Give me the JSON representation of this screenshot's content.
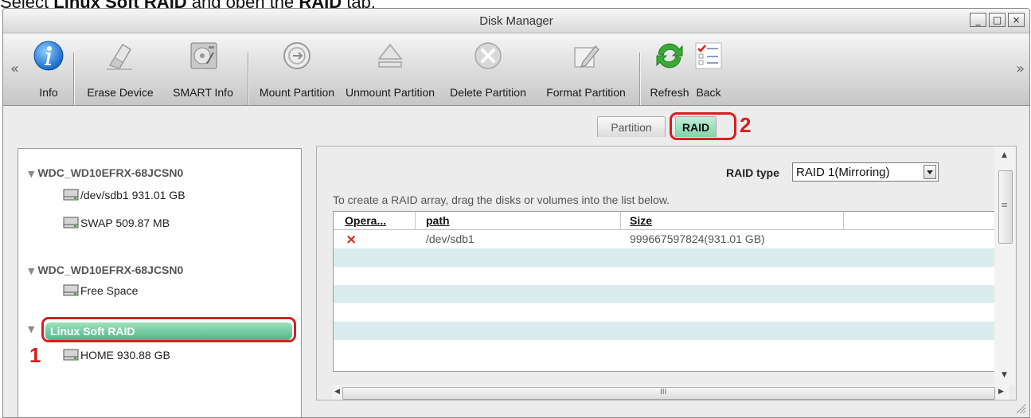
{
  "caption": {
    "verb": "Select ",
    "bold1": "Linux Soft RAID",
    "mid": " and open the ",
    "bold2": "RAID",
    "end": " tab."
  },
  "window": {
    "title": "Disk Manager",
    "controls": {
      "minimize": "_",
      "maximize": "□",
      "close": "×"
    }
  },
  "toolbar": {
    "scroll_left": "«",
    "scroll_right": "»",
    "buttons": [
      {
        "label": "Info",
        "icon": "info-icon"
      },
      {
        "label": "Erase Device",
        "icon": "eraser-icon"
      },
      {
        "label": "SMART Info",
        "icon": "hard-drive-icon"
      },
      {
        "label": "Mount Partition",
        "icon": "mount-icon"
      },
      {
        "label": "Unmount Partition",
        "icon": "eject-icon"
      },
      {
        "label": "Delete Partition",
        "icon": "delete-icon"
      },
      {
        "label": "Format Partition",
        "icon": "format-pencil-icon"
      },
      {
        "label": "Refresh",
        "icon": "refresh-icon"
      },
      {
        "label": "Back",
        "icon": "checklist-icon"
      }
    ]
  },
  "tabs": {
    "partition": "Partition",
    "raid": "RAID",
    "active": "RAID"
  },
  "annotations": {
    "step1": "1",
    "step2": "2",
    "color": "#d81e1e"
  },
  "tree": {
    "disks": [
      {
        "name": "WDC_WD10EFRX-68JCSN0",
        "items": [
          "/dev/sdb1 931.01 GB",
          "SWAP 509.87 MB"
        ]
      },
      {
        "name": "WDC_WD10EFRX-68JCSN0",
        "items": [
          "Free Space"
        ]
      }
    ],
    "raid": {
      "name": "Linux Soft RAID",
      "items": [
        "HOME 930.88 GB"
      ],
      "selected": true
    }
  },
  "raid_panel": {
    "raid_type_label": "RAID type",
    "raid_type_value": "RAID 1(Mirroring)",
    "instructions": "To create a RAID array, drag the disks or volumes into the list below.",
    "columns": [
      "Opera...",
      "path",
      "Size"
    ],
    "rows": [
      {
        "operation": "×",
        "path": "/dev/sdb1",
        "size": "999667597824(931.01 GB)"
      }
    ],
    "scrollbar_mid": "≡",
    "hscroll_mid": "III"
  },
  "colors": {
    "accent_green": "#4fb888",
    "delete_red": "#d42020",
    "row_alt": "#dbecef"
  }
}
